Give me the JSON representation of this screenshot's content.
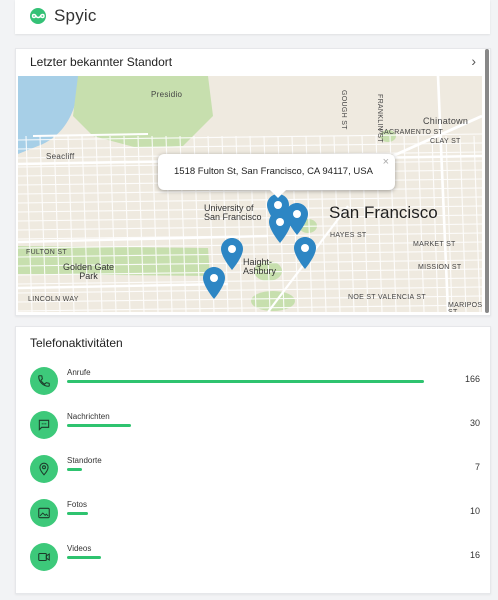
{
  "app": {
    "name": "Spyic"
  },
  "location_card": {
    "title": "Letzter bekannter Standort",
    "popup_address": "1518 Fulton St, San Francisco, CA 94117, USA",
    "popup_close": "×",
    "more": "›"
  },
  "map": {
    "labels": {
      "presidio": "Presidio",
      "seacliff": "Seacliff",
      "university": "University of",
      "university2": "San Francisco",
      "city": "San Francisco",
      "haight": "Haight-",
      "haight2": "Ashbury",
      "golden_gate": "Golden Gate",
      "park": "Park",
      "chinatown": "Chinatown",
      "fulton": "FULTON ST",
      "lincoln": "LINCOLN WAY",
      "sacramento": "SACRAMENTO ST",
      "clay": "CLAY ST",
      "market": "MARKET ST",
      "mission": "MISSION ST",
      "valencia": "VALENCIA ST",
      "mariposa": "MARIPOSA ST",
      "noe": "NOE ST",
      "franklin": "FRANKLIN ST",
      "gough": "GOUGH ST",
      "hayes": "HAYES ST"
    },
    "colors": {
      "water": "#a7cfe7",
      "park": "#c7dfae",
      "road": "#ffffff",
      "pin": "#2d86c4"
    }
  },
  "activity_card": {
    "title": "Telefonaktivitäten",
    "items": [
      {
        "label": "Anrufe",
        "count": "166",
        "fraction": 1.0,
        "icon": "phone-icon"
      },
      {
        "label": "Nachrichten",
        "count": "30",
        "fraction": 0.18,
        "icon": "message-icon"
      },
      {
        "label": "Standorte",
        "count": "7",
        "fraction": 0.042,
        "icon": "location-icon"
      },
      {
        "label": "Fotos",
        "count": "10",
        "fraction": 0.06,
        "icon": "photo-icon"
      },
      {
        "label": "Videos",
        "count": "16",
        "fraction": 0.096,
        "icon": "video-icon"
      }
    ]
  }
}
